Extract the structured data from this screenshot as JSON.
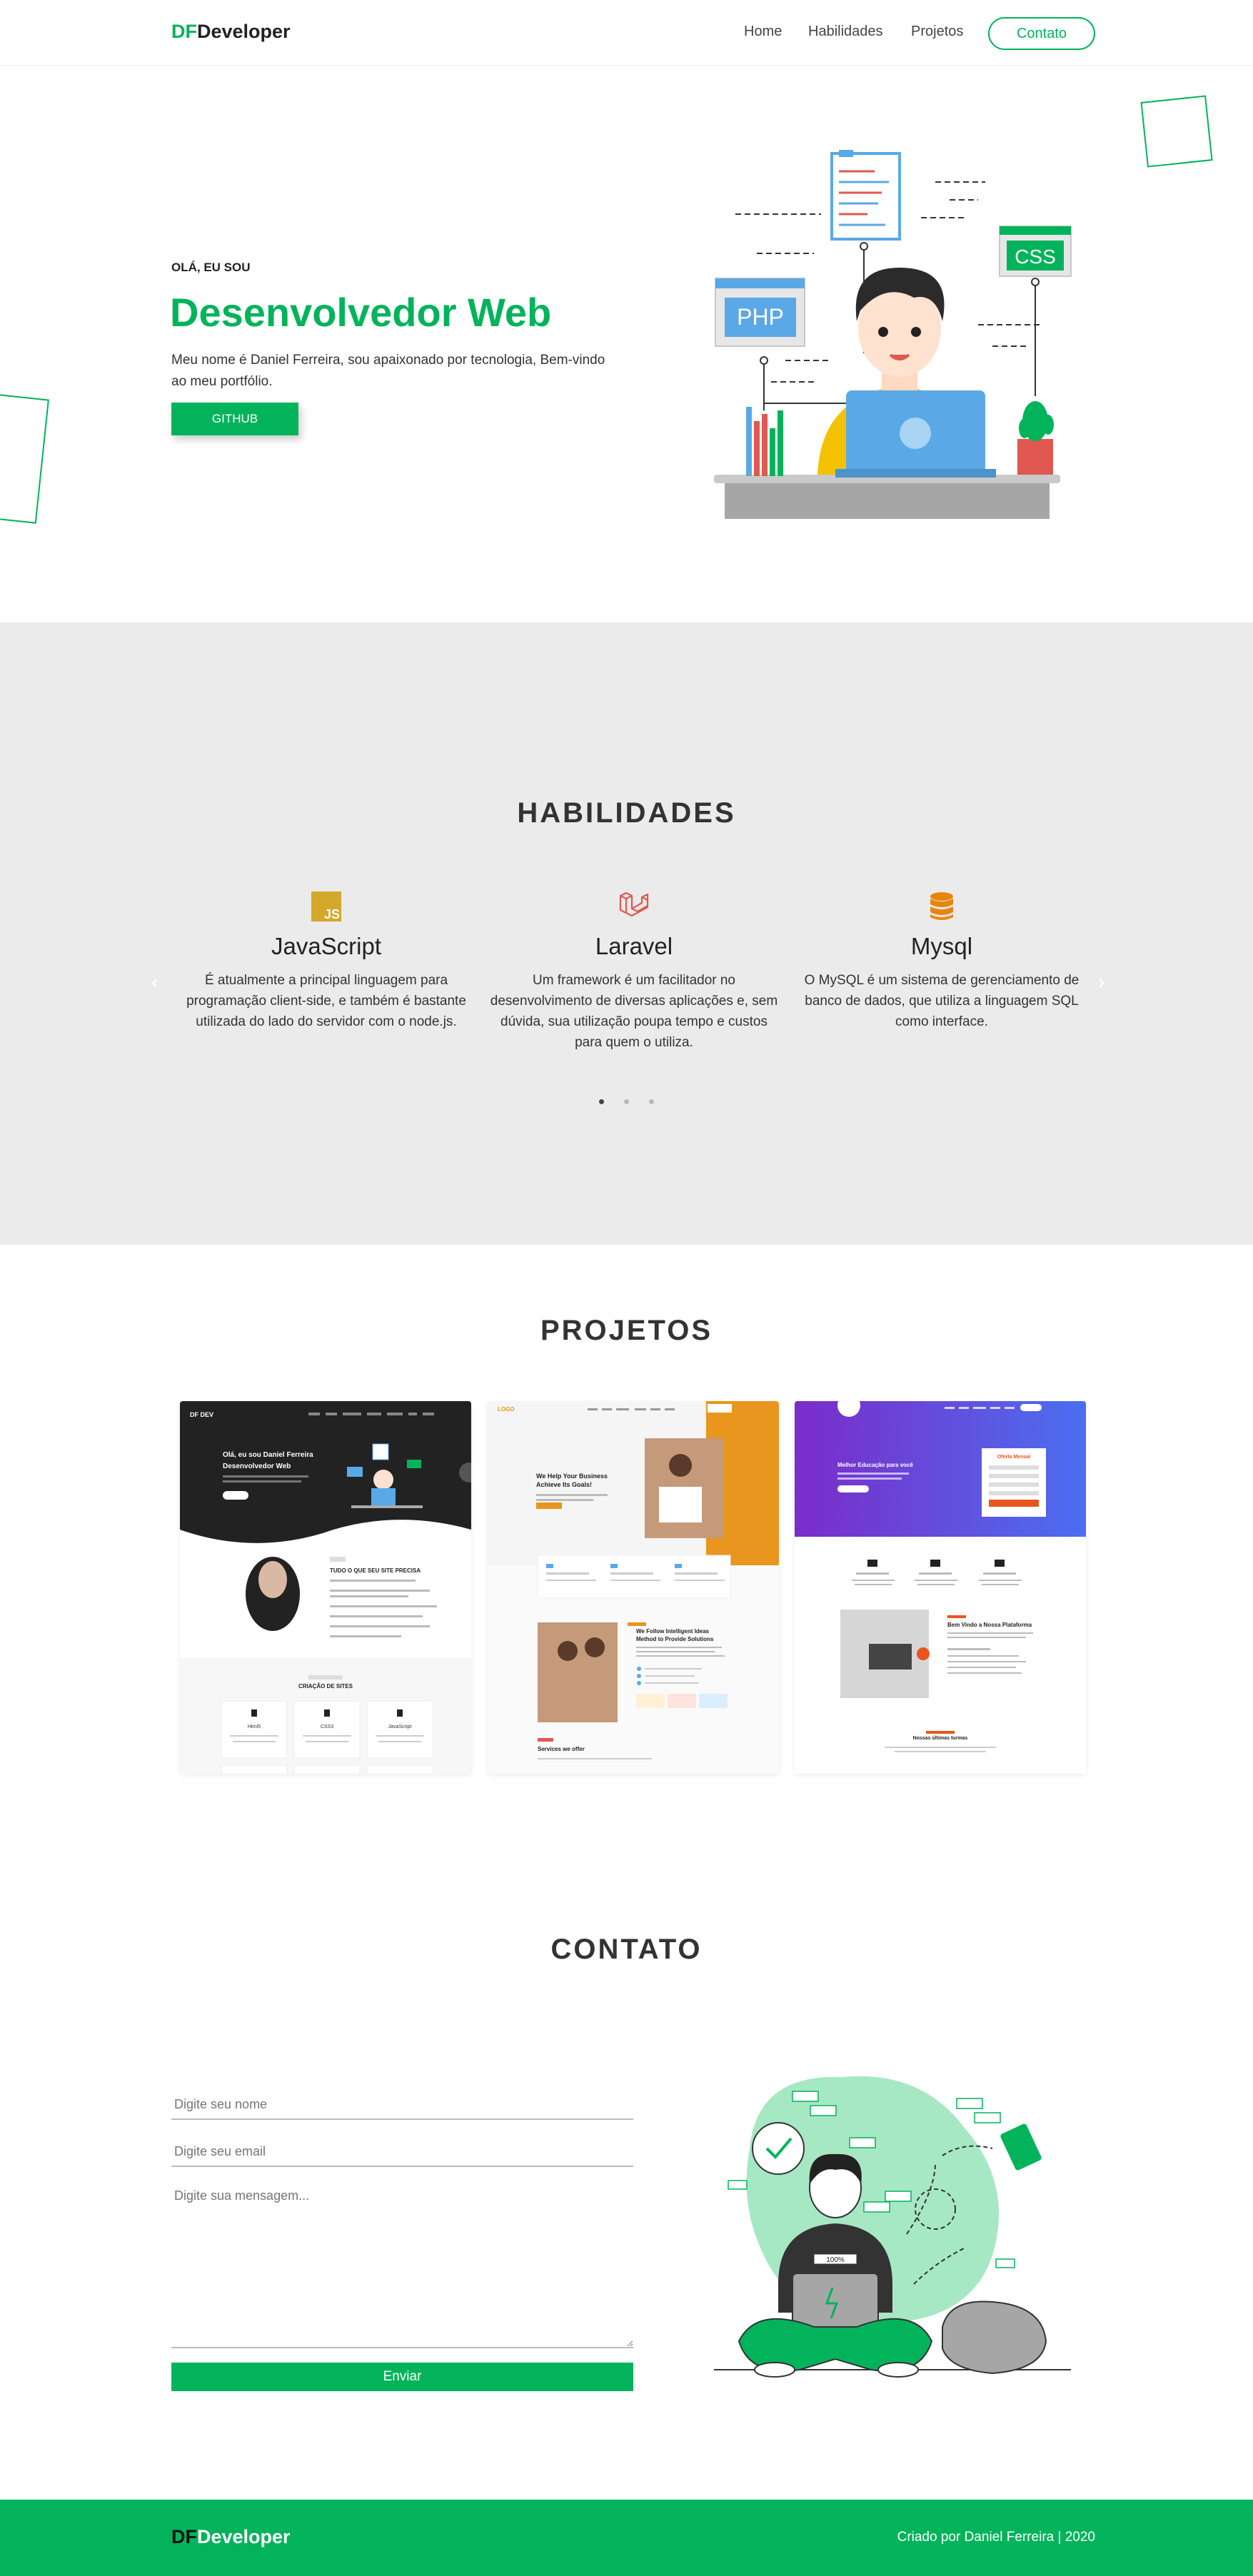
{
  "nav": {
    "brand_prefix": "DF",
    "brand_suffix": "Developer",
    "links": [
      "Home",
      "Habilidades",
      "Projetos"
    ],
    "contact_label": "Contato"
  },
  "hero": {
    "kicker": "OLÁ, EU SOU",
    "title": "Desenvolvedor Web",
    "description": "Meu nome é Daniel Ferreira, sou apaixonado por tecnologia, Bem-vindo ao meu portfólio.",
    "button_label": "GITHUB",
    "illustration_labels": [
      "PHP",
      "CSS"
    ]
  },
  "skills": {
    "title": "HABILIDADES",
    "items": [
      {
        "icon": "js-icon",
        "badge": "JS",
        "name": "JavaScript",
        "description": "É atualmente a principal linguagem para programação client-side, e também é bastante utilizada do lado do servidor com o node.js."
      },
      {
        "icon": "laravel-icon",
        "name": "Laravel",
        "description": "Um framework é um facilitador no desenvolvimento de diversas aplicações e, sem dúvida, sua utilização poupa tempo e custos para quem o utiliza."
      },
      {
        "icon": "database-icon",
        "name": "Mysql",
        "description": "O MySQL é um sistema de gerenciamento de banco de dados, que utiliza a linguagem SQL como interface."
      }
    ],
    "prev_icon": "chevron-left-icon",
    "next_icon": "chevron-right-icon",
    "prev_glyph": "‹",
    "next_glyph": "›",
    "active_slide": 0,
    "slide_count": 3
  },
  "projects": {
    "title": "PROJETOS",
    "items": [
      {
        "brand": "DF DEV",
        "headline_1": "Olá, eu sou Daniel Ferreira",
        "headline_2": "Desenvolvedor Web",
        "section_1": "TUDO O QUE SEU SITE PRECISA",
        "section_2": "CRIAÇÃO DE SITES",
        "cards": [
          "Html5",
          "CSS3",
          "JavaScript"
        ]
      },
      {
        "brand": "LOGO",
        "headline_1": "We Help Your Business",
        "headline_2": "Achieve Its Goals!",
        "section_1": "We Follow Intelligent Ideas",
        "section_2": "Method to Provide Solutions",
        "section_3": "Services we offer"
      },
      {
        "headline_1": "Melhor Educação para você",
        "panel": "Oferta Mensal",
        "section_1": "Bem Vindo a Nossa Plataforma",
        "section_2": "Nossas últimas turmas"
      }
    ]
  },
  "contact": {
    "title": "CONTATO",
    "name_placeholder": "Digite seu nome",
    "email_placeholder": "Digite seu email",
    "message_placeholder": "Digite sua mensagem...",
    "send_label": "Enviar",
    "illustration_badge": "100%"
  },
  "footer": {
    "brand_prefix": "DF",
    "brand_suffix": "Developer",
    "credit": "Criado por Daniel Ferreira | 2020"
  },
  "colors": {
    "accent": "#02b35b",
    "section_bg": "#ebebeb",
    "text_dark": "#222222"
  }
}
